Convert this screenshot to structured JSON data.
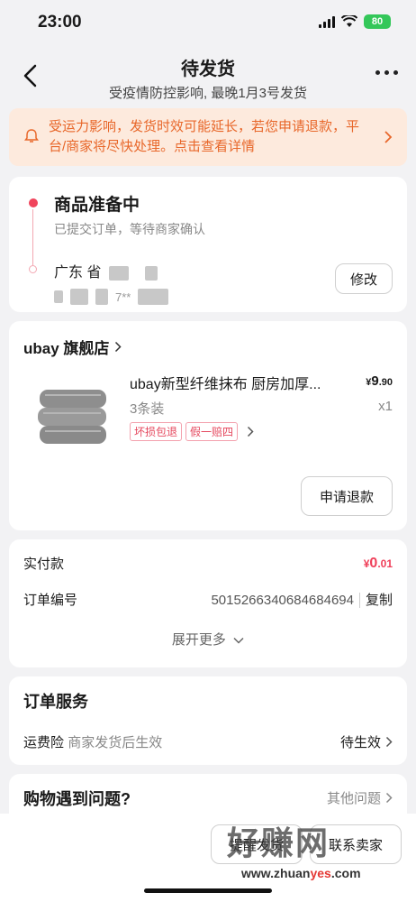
{
  "status_bar": {
    "time": "23:00",
    "battery": "80"
  },
  "nav": {
    "title": "待发货",
    "subtitle": "受疫情防控影响, 最晚1月3号发货"
  },
  "notice": {
    "text": "受运力影响，发货时效可能延长，若您申请退款，平台/商家将尽快处理。点击查看详情"
  },
  "shipping": {
    "status_title": "商品准备中",
    "status_sub": "已提交订单，等待商家确认",
    "address_line1": "广东 省",
    "address_line2": "7**",
    "edit_label": "修改"
  },
  "store": {
    "name": "ubay 旗舰店",
    "product": {
      "name": "ubay新型纤维抹布 厨房加厚...",
      "price_symbol": "¥",
      "price_main": "9",
      "price_decimal": ".90",
      "spec": "3条装",
      "qty": "x1",
      "tags": [
        "坏损包退",
        "假一赔四"
      ]
    },
    "refund_label": "申请退款"
  },
  "order": {
    "paid_label": "实付款",
    "paid_symbol": "¥",
    "paid_main": "0",
    "paid_decimal": ".01",
    "order_no_label": "订单编号",
    "order_no": "5015266340684684694",
    "copy_label": "复制",
    "expand_label": "展开更多"
  },
  "service": {
    "title": "订单服务",
    "item_label": "运费险",
    "item_desc": "商家发货后生效",
    "item_status": "待生效"
  },
  "help": {
    "title": "购物遇到问题?",
    "other_label": "其他问题"
  },
  "bottom": {
    "btn1": "提醒发货",
    "btn2": "联系卖家"
  },
  "watermark": {
    "main": "好赚网",
    "sub_a": "www.zhuan",
    "sub_b": "yes",
    "sub_c": ".com"
  },
  "colors": {
    "accent": "#ef3f59",
    "notice_bg": "#fdeadd",
    "notice_text": "#e8672a"
  }
}
